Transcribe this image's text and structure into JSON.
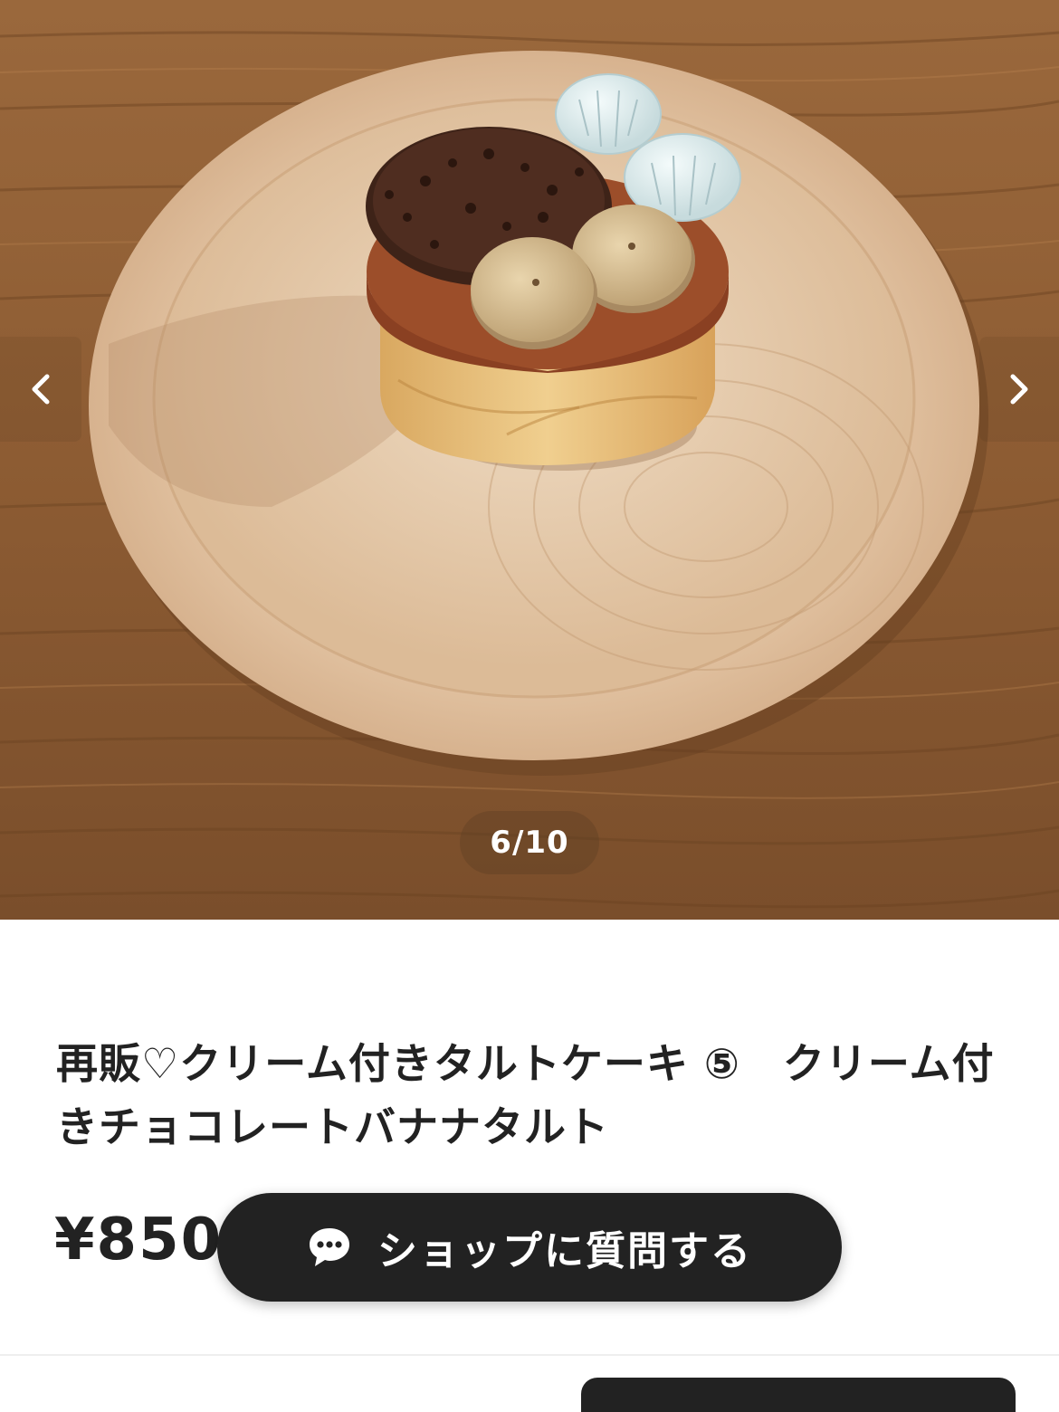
{
  "gallery": {
    "counter": "6/10",
    "prev_icon": "chevron-left-icon",
    "next_icon": "chevron-right-icon"
  },
  "product": {
    "title": "再販♡クリーム付きタルトケーキ ⑤　クリーム付きチョコレートバナナタルト",
    "price": "¥850"
  },
  "ask_shop": {
    "label": "ショップに質問する",
    "icon": "chat-bubble-icon"
  },
  "colors": {
    "text": "#222222",
    "button_bg": "#222222",
    "button_text": "#ffffff"
  }
}
